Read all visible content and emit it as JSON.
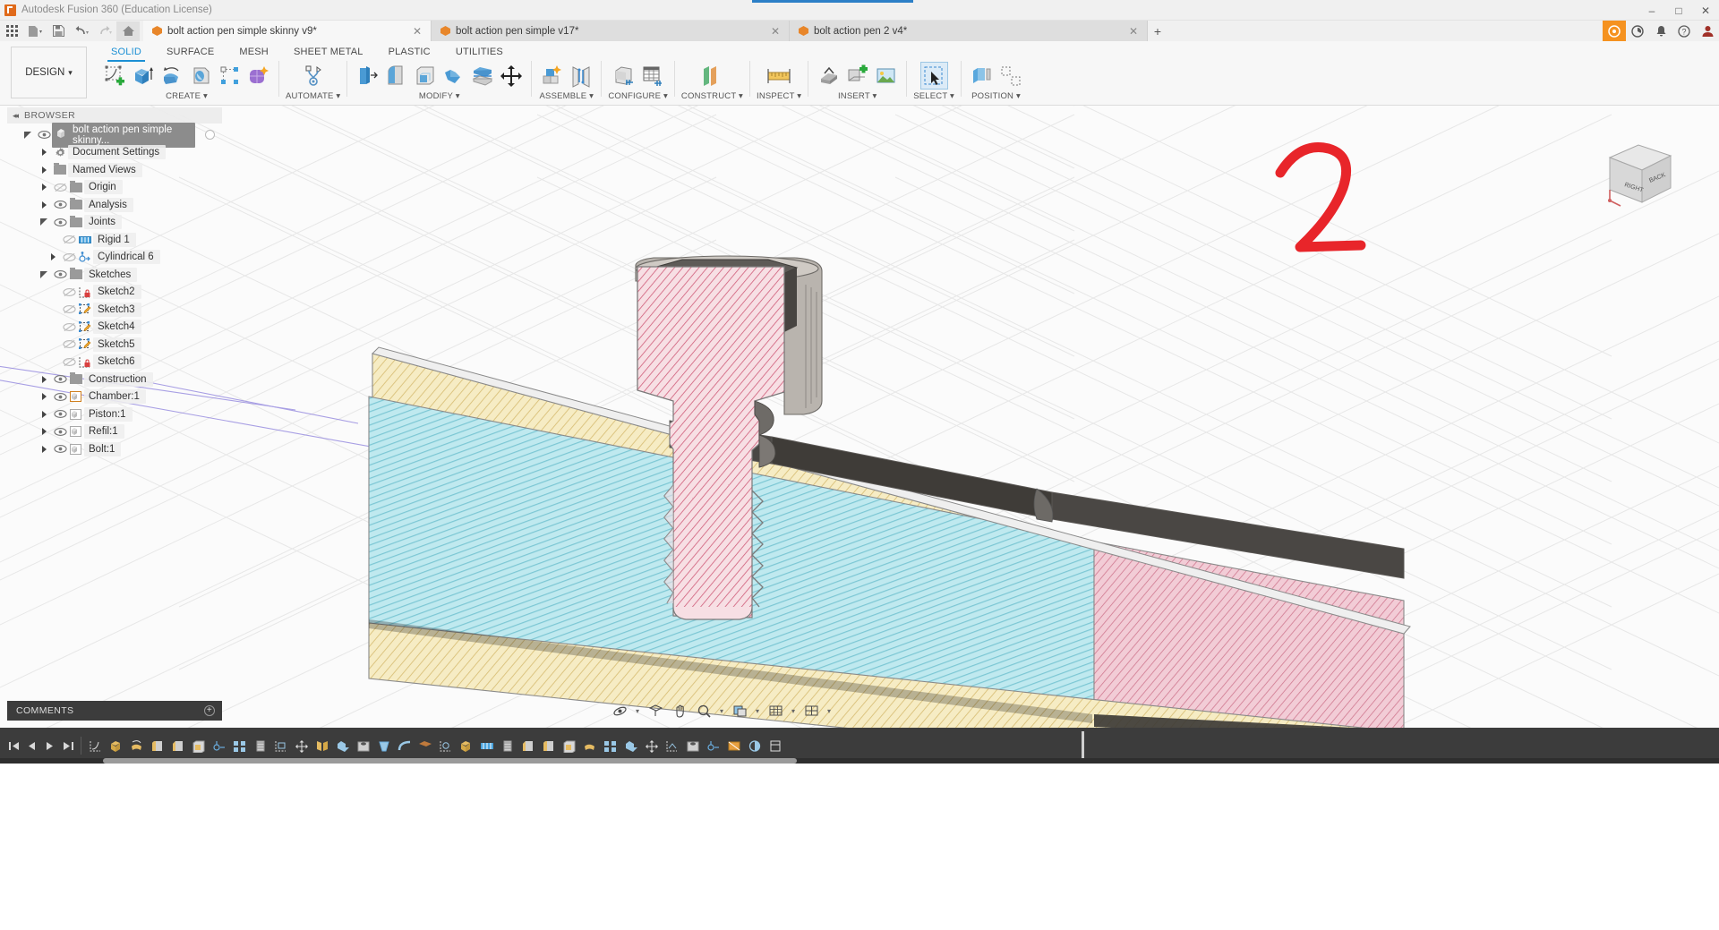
{
  "titlebar": {
    "app_title": "Autodesk Fusion 360 (Education License)",
    "minimize": "–",
    "maximize": "□",
    "close": "✕"
  },
  "quick_access": {
    "buttons": [
      {
        "name": "app-grid-icon",
        "glyph": "∷"
      },
      {
        "name": "new-file-icon",
        "glyph": "▤"
      },
      {
        "name": "save-icon",
        "glyph": "💾"
      },
      {
        "name": "undo-icon",
        "glyph": "↶"
      },
      {
        "name": "redo-icon",
        "glyph": "↷"
      },
      {
        "name": "home-icon",
        "glyph": "⌂"
      }
    ],
    "tabs": [
      {
        "label": "bolt action pen simple skinny v9*",
        "active": true,
        "close": "✕"
      },
      {
        "label": "bolt action pen simple v17*",
        "active": false,
        "close": "✕"
      },
      {
        "label": "bolt action pen 2 v4*",
        "active": false,
        "close": "✕"
      }
    ],
    "add_tab": "+",
    "right_buttons": [
      {
        "name": "fusion-badge-icon",
        "glyph": "◉"
      },
      {
        "name": "jobs-status-icon",
        "glyph": "◔"
      },
      {
        "name": "notifications-bell-icon",
        "glyph": "🔔"
      },
      {
        "name": "help-icon",
        "glyph": "?"
      },
      {
        "name": "user-account-icon",
        "glyph": "☺"
      }
    ]
  },
  "ribbon": {
    "workspace_label": "DESIGN",
    "workspace_caret": "▾",
    "tabs": [
      {
        "label": "SOLID",
        "active": true
      },
      {
        "label": "SURFACE",
        "active": false
      },
      {
        "label": "MESH",
        "active": false
      },
      {
        "label": "SHEET METAL",
        "active": false
      },
      {
        "label": "PLASTIC",
        "active": false
      },
      {
        "label": "UTILITIES",
        "active": false
      }
    ],
    "groups": [
      {
        "label": "CREATE ▾",
        "name": "create-group",
        "icons": [
          "create-sketch-icon",
          "extrude-icon",
          "revolve-icon",
          "sweep-icon",
          "pattern-icon",
          "form-icon"
        ]
      },
      {
        "label": "AUTOMATE ▾",
        "name": "automate-group",
        "icons": [
          "automate-icon"
        ]
      },
      {
        "label": "MODIFY ▾",
        "name": "modify-group",
        "icons": [
          "press-pull-icon",
          "fillet-icon",
          "shell-icon",
          "combine-icon",
          "offset-face-icon",
          "move-copy-icon"
        ]
      },
      {
        "label": "ASSEMBLE ▾",
        "name": "assemble-group",
        "icons": [
          "new-component-icon",
          "joint-icon"
        ]
      },
      {
        "label": "CONFIGURE ▾",
        "name": "configure-group",
        "icons": [
          "configure-part-icon",
          "configure-table-icon"
        ]
      },
      {
        "label": "CONSTRUCT ▾",
        "name": "construct-group",
        "icons": [
          "offset-plane-icon"
        ]
      },
      {
        "label": "INSPECT ▾",
        "name": "inspect-group",
        "icons": [
          "measure-icon"
        ]
      },
      {
        "label": "INSERT ▾",
        "name": "insert-group",
        "icons": [
          "insert-derive-icon",
          "insert-mcmaster-icon",
          "insert-canvas-icon"
        ]
      },
      {
        "label": "SELECT ▾",
        "name": "select-group",
        "icons": [
          "select-cursor-icon"
        ]
      },
      {
        "label": "POSITION ▾",
        "name": "position-group",
        "icons": [
          "position-move-icon",
          "position-align-icon"
        ]
      }
    ]
  },
  "browser": {
    "header": "BROWSER",
    "collapse_glyph": "◂◂",
    "items": [
      {
        "label": "bolt action pen simple skinny...",
        "indent": 0,
        "caret": "open",
        "eye": "on",
        "icon": "component-icon",
        "selected": true
      },
      {
        "label": "Document Settings",
        "indent": 1,
        "caret": "closed",
        "eye": "none",
        "icon": "gear-icon",
        "selected": false
      },
      {
        "label": "Named Views",
        "indent": 1,
        "caret": "closed",
        "eye": "none",
        "icon": "folder-icon",
        "selected": false
      },
      {
        "label": "Origin",
        "indent": 1,
        "caret": "closed",
        "eye": "off",
        "icon": "folder-icon",
        "selected": false
      },
      {
        "label": "Analysis",
        "indent": 1,
        "caret": "closed",
        "eye": "on",
        "icon": "folder-icon",
        "selected": false
      },
      {
        "label": "Joints",
        "indent": 1,
        "caret": "open",
        "eye": "on",
        "icon": "folder-icon",
        "selected": false
      },
      {
        "label": "Rigid 1",
        "indent": 2,
        "caret": "none",
        "eye": "off",
        "icon": "rigid-joint-icon",
        "selected": false
      },
      {
        "label": "Cylindrical 6",
        "indent": 2,
        "caret": "closed",
        "eye": "off",
        "icon": "cylindrical-joint-icon",
        "selected": false
      },
      {
        "label": "Sketches",
        "indent": 1,
        "caret": "open",
        "eye": "on",
        "icon": "folder-icon",
        "selected": false
      },
      {
        "label": "Sketch2",
        "indent": 2,
        "caret": "none",
        "eye": "off",
        "icon": "sketch-locked-icon",
        "selected": false
      },
      {
        "label": "Sketch3",
        "indent": 2,
        "caret": "none",
        "eye": "off",
        "icon": "sketch-icon",
        "selected": false
      },
      {
        "label": "Sketch4",
        "indent": 2,
        "caret": "none",
        "eye": "off",
        "icon": "sketch-icon",
        "selected": false
      },
      {
        "label": "Sketch5",
        "indent": 2,
        "caret": "none",
        "eye": "off",
        "icon": "sketch-icon",
        "selected": false
      },
      {
        "label": "Sketch6",
        "indent": 2,
        "caret": "none",
        "eye": "off",
        "icon": "sketch-locked-icon",
        "selected": false
      },
      {
        "label": "Construction",
        "indent": 1,
        "caret": "closed",
        "eye": "on",
        "icon": "folder-icon",
        "selected": false
      },
      {
        "label": "Chamber:1",
        "indent": 1,
        "caret": "closed",
        "eye": "on",
        "icon": "component-active-icon",
        "selected": false
      },
      {
        "label": "Piston:1",
        "indent": 1,
        "caret": "closed",
        "eye": "on",
        "icon": "component-icon",
        "selected": false
      },
      {
        "label": "Refil:1",
        "indent": 1,
        "caret": "closed",
        "eye": "on",
        "icon": "component-icon",
        "selected": false
      },
      {
        "label": "Bolt:1",
        "indent": 1,
        "caret": "closed",
        "eye": "on",
        "icon": "component-icon",
        "selected": false
      }
    ]
  },
  "canvas": {
    "annotation": "2",
    "annotation_color": "#e8252a",
    "viewcube": {
      "front_face": "RIGHT",
      "side_face": "BACK"
    },
    "model_colors": {
      "bolt_section": "#f2c3ce",
      "body_section_cyan": "#a8e0e8",
      "body_section_yellow": "#f2e3b0",
      "refill_pink": "#f0b8c6",
      "dark_cavity": "#46433f",
      "bolt_head_gray": "#b5b0aa",
      "hatch_line": "#c04a66"
    },
    "grid_color": "#e6e6e6"
  },
  "comments": {
    "label": "COMMENTS",
    "add_glyph": "+"
  },
  "navbar": {
    "buttons": [
      {
        "name": "orbit-icon",
        "glyph": "⥂"
      },
      {
        "name": "pan-hand-icon",
        "glyph": "✋"
      },
      {
        "name": "zoom-magnifier-icon",
        "glyph": "⌕"
      },
      {
        "name": "display-settings-icon",
        "glyph": "▣"
      },
      {
        "name": "grid-snaps-icon",
        "glyph": "⊞"
      },
      {
        "name": "viewports-icon",
        "glyph": "⌸"
      }
    ]
  },
  "timeline": {
    "playback": [
      {
        "name": "timeline-go-start-icon",
        "glyph": "⏮"
      },
      {
        "name": "timeline-step-back-icon",
        "glyph": "◀"
      },
      {
        "name": "timeline-play-icon",
        "glyph": "▶"
      },
      {
        "name": "timeline-go-end-icon",
        "glyph": "⏭"
      }
    ],
    "feature_count": 34,
    "marker_position_px": 1208
  }
}
